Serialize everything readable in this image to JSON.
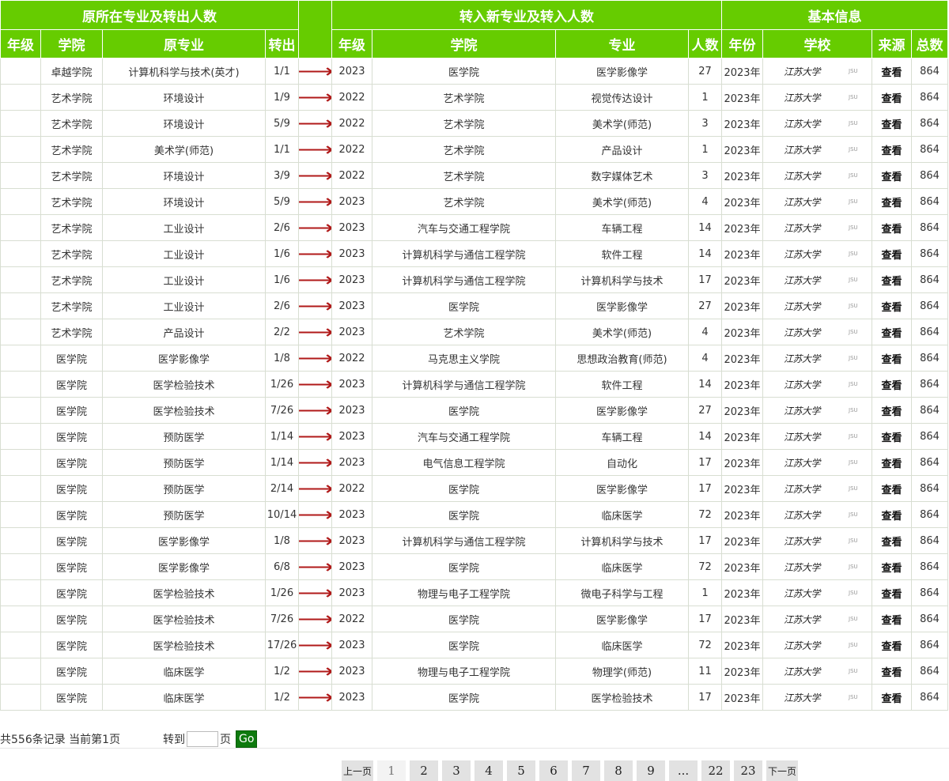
{
  "header": {
    "group_from": "原所在专业及转出人数",
    "group_to": "转入新专业及转入人数",
    "group_info": "基本信息",
    "columns": [
      "年级",
      "学院",
      "原专业",
      "转出",
      "年级",
      "学院",
      "专业",
      "人数",
      "年份",
      "学校",
      "来源",
      "总数"
    ]
  },
  "school_logo_text": "江苏大学",
  "school_logo_sub": "JSU",
  "arrow_glyph": "⟶",
  "rows": [
    {
      "from_grade": "",
      "from_college": "卓越学院",
      "from_major": "计算机科学与技术(英才)",
      "out": "1/1",
      "to_grade": "2023",
      "to_college": "医学院",
      "to_major": "医学影像学",
      "count": "27",
      "year": "2023年",
      "source": "查看",
      "total": "864"
    },
    {
      "from_grade": "",
      "from_college": "艺术学院",
      "from_major": "环境设计",
      "out": "1/9",
      "to_grade": "2022",
      "to_college": "艺术学院",
      "to_major": "视觉传达设计",
      "count": "1",
      "year": "2023年",
      "source": "查看",
      "total": "864"
    },
    {
      "from_grade": "",
      "from_college": "艺术学院",
      "from_major": "环境设计",
      "out": "5/9",
      "to_grade": "2022",
      "to_college": "艺术学院",
      "to_major": "美术学(师范)",
      "count": "3",
      "year": "2023年",
      "source": "查看",
      "total": "864"
    },
    {
      "from_grade": "",
      "from_college": "艺术学院",
      "from_major": "美术学(师范)",
      "out": "1/1",
      "to_grade": "2022",
      "to_college": "艺术学院",
      "to_major": "产品设计",
      "count": "1",
      "year": "2023年",
      "source": "查看",
      "total": "864"
    },
    {
      "from_grade": "",
      "from_college": "艺术学院",
      "from_major": "环境设计",
      "out": "3/9",
      "to_grade": "2022",
      "to_college": "艺术学院",
      "to_major": "数字媒体艺术",
      "count": "3",
      "year": "2023年",
      "source": "查看",
      "total": "864"
    },
    {
      "from_grade": "",
      "from_college": "艺术学院",
      "from_major": "环境设计",
      "out": "5/9",
      "to_grade": "2023",
      "to_college": "艺术学院",
      "to_major": "美术学(师范)",
      "count": "4",
      "year": "2023年",
      "source": "查看",
      "total": "864"
    },
    {
      "from_grade": "",
      "from_college": "艺术学院",
      "from_major": "工业设计",
      "out": "2/6",
      "to_grade": "2023",
      "to_college": "汽车与交通工程学院",
      "to_major": "车辆工程",
      "count": "14",
      "year": "2023年",
      "source": "查看",
      "total": "864"
    },
    {
      "from_grade": "",
      "from_college": "艺术学院",
      "from_major": "工业设计",
      "out": "1/6",
      "to_grade": "2023",
      "to_college": "计算机科学与通信工程学院",
      "to_major": "软件工程",
      "count": "14",
      "year": "2023年",
      "source": "查看",
      "total": "864"
    },
    {
      "from_grade": "",
      "from_college": "艺术学院",
      "from_major": "工业设计",
      "out": "1/6",
      "to_grade": "2023",
      "to_college": "计算机科学与通信工程学院",
      "to_major": "计算机科学与技术",
      "count": "17",
      "year": "2023年",
      "source": "查看",
      "total": "864"
    },
    {
      "from_grade": "",
      "from_college": "艺术学院",
      "from_major": "工业设计",
      "out": "2/6",
      "to_grade": "2023",
      "to_college": "医学院",
      "to_major": "医学影像学",
      "count": "27",
      "year": "2023年",
      "source": "查看",
      "total": "864"
    },
    {
      "from_grade": "",
      "from_college": "艺术学院",
      "from_major": "产品设计",
      "out": "2/2",
      "to_grade": "2023",
      "to_college": "艺术学院",
      "to_major": "美术学(师范)",
      "count": "4",
      "year": "2023年",
      "source": "查看",
      "total": "864"
    },
    {
      "from_grade": "",
      "from_college": "医学院",
      "from_major": "医学影像学",
      "out": "1/8",
      "to_grade": "2022",
      "to_college": "马克思主义学院",
      "to_major": "思想政治教育(师范)",
      "count": "4",
      "year": "2023年",
      "source": "查看",
      "total": "864"
    },
    {
      "from_grade": "",
      "from_college": "医学院",
      "from_major": "医学检验技术",
      "out": "1/26",
      "to_grade": "2023",
      "to_college": "计算机科学与通信工程学院",
      "to_major": "软件工程",
      "count": "14",
      "year": "2023年",
      "source": "查看",
      "total": "864"
    },
    {
      "from_grade": "",
      "from_college": "医学院",
      "from_major": "医学检验技术",
      "out": "7/26",
      "to_grade": "2023",
      "to_college": "医学院",
      "to_major": "医学影像学",
      "count": "27",
      "year": "2023年",
      "source": "查看",
      "total": "864"
    },
    {
      "from_grade": "",
      "from_college": "医学院",
      "from_major": "预防医学",
      "out": "1/14",
      "to_grade": "2023",
      "to_college": "汽车与交通工程学院",
      "to_major": "车辆工程",
      "count": "14",
      "year": "2023年",
      "source": "查看",
      "total": "864"
    },
    {
      "from_grade": "",
      "from_college": "医学院",
      "from_major": "预防医学",
      "out": "1/14",
      "to_grade": "2023",
      "to_college": "电气信息工程学院",
      "to_major": "自动化",
      "count": "17",
      "year": "2023年",
      "source": "查看",
      "total": "864"
    },
    {
      "from_grade": "",
      "from_college": "医学院",
      "from_major": "预防医学",
      "out": "2/14",
      "to_grade": "2022",
      "to_college": "医学院",
      "to_major": "医学影像学",
      "count": "17",
      "year": "2023年",
      "source": "查看",
      "total": "864"
    },
    {
      "from_grade": "",
      "from_college": "医学院",
      "from_major": "预防医学",
      "out": "10/14",
      "to_grade": "2023",
      "to_college": "医学院",
      "to_major": "临床医学",
      "count": "72",
      "year": "2023年",
      "source": "查看",
      "total": "864"
    },
    {
      "from_grade": "",
      "from_college": "医学院",
      "from_major": "医学影像学",
      "out": "1/8",
      "to_grade": "2023",
      "to_college": "计算机科学与通信工程学院",
      "to_major": "计算机科学与技术",
      "count": "17",
      "year": "2023年",
      "source": "查看",
      "total": "864"
    },
    {
      "from_grade": "",
      "from_college": "医学院",
      "from_major": "医学影像学",
      "out": "6/8",
      "to_grade": "2023",
      "to_college": "医学院",
      "to_major": "临床医学",
      "count": "72",
      "year": "2023年",
      "source": "查看",
      "total": "864"
    },
    {
      "from_grade": "",
      "from_college": "医学院",
      "from_major": "医学检验技术",
      "out": "1/26",
      "to_grade": "2023",
      "to_college": "物理与电子工程学院",
      "to_major": "微电子科学与工程",
      "count": "1",
      "year": "2023年",
      "source": "查看",
      "total": "864"
    },
    {
      "from_grade": "",
      "from_college": "医学院",
      "from_major": "医学检验技术",
      "out": "7/26",
      "to_grade": "2022",
      "to_college": "医学院",
      "to_major": "医学影像学",
      "count": "17",
      "year": "2023年",
      "source": "查看",
      "total": "864"
    },
    {
      "from_grade": "",
      "from_college": "医学院",
      "from_major": "医学检验技术",
      "out": "17/26",
      "to_grade": "2023",
      "to_college": "医学院",
      "to_major": "临床医学",
      "count": "72",
      "year": "2023年",
      "source": "查看",
      "total": "864"
    },
    {
      "from_grade": "",
      "from_college": "医学院",
      "from_major": "临床医学",
      "out": "1/2",
      "to_grade": "2023",
      "to_college": "物理与电子工程学院",
      "to_major": "物理学(师范)",
      "count": "11",
      "year": "2023年",
      "source": "查看",
      "total": "864"
    },
    {
      "from_grade": "",
      "from_college": "医学院",
      "from_major": "临床医学",
      "out": "1/2",
      "to_grade": "2023",
      "to_college": "医学院",
      "to_major": "医学检验技术",
      "count": "17",
      "year": "2023年",
      "source": "查看",
      "total": "864"
    }
  ],
  "status": {
    "total_text": "共556条记录 当前第1页",
    "goto_label": "转到",
    "page_unit": "页",
    "page_input_value": "",
    "go_label": "Go"
  },
  "pagination": {
    "prev": "上一页",
    "next": "下一页",
    "current": "1",
    "pages": [
      "1",
      "2",
      "3",
      "4",
      "5",
      "6",
      "7",
      "8",
      "9",
      "...",
      "22",
      "23"
    ]
  },
  "colors": {
    "header_green": "#66cc00",
    "arrow_red": "#b01919",
    "go_green": "#0e7a0e"
  }
}
